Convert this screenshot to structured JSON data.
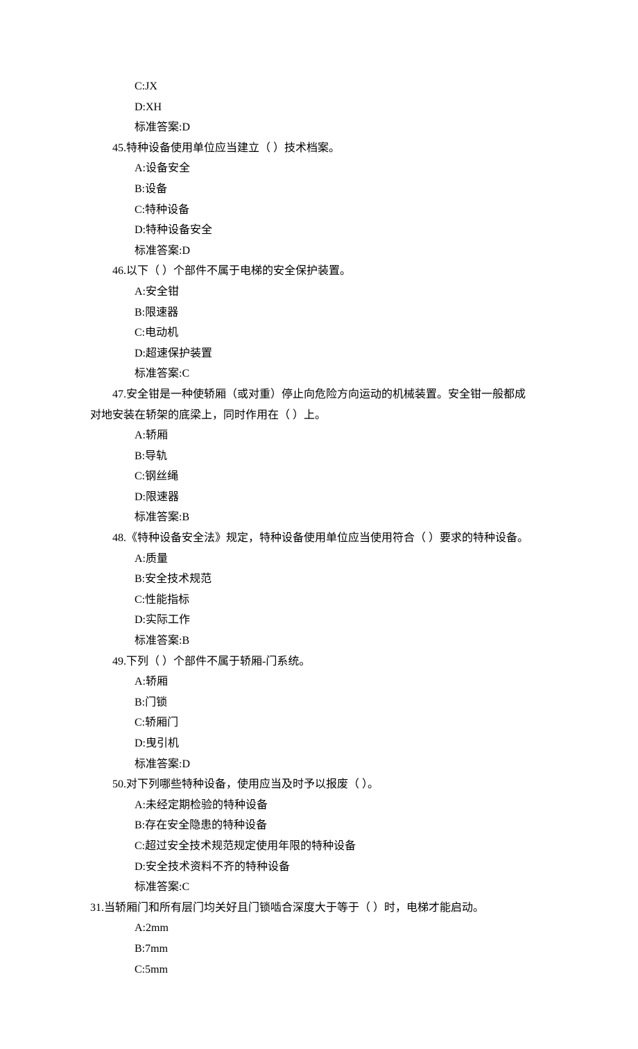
{
  "leading": {
    "cText": "C:JX",
    "dText": "D:XH",
    "answer": "标准答案:D"
  },
  "questions": [
    {
      "num": "45",
      "stem": "特种设备使用单位应当建立（  ）技术档案。",
      "opts": [
        "A:设备安全",
        "B:设备",
        "C:特种设备",
        "D:特种设备安全"
      ],
      "answer": "标准答案:D"
    },
    {
      "num": "46",
      "stem": "以下（  ）个部件不属于电梯的安全保护装置。",
      "opts": [
        "A:安全钳",
        "B:限速器",
        "C:电动机",
        "D:超速保护装置"
      ],
      "answer": "标准答案:C"
    },
    {
      "num": "47",
      "stem_line1": "47.安全钳是一种使轿厢（或对重）停止向危险方向运动的机械装置。安全钳一般都成",
      "stem_line2": "对地安装在轿架的底梁上，同时作用在（  ）上。",
      "opts": [
        "A:轿厢",
        "B:导轨",
        "C:钢丝绳",
        "D:限速器"
      ],
      "answer": "标准答案:B"
    },
    {
      "num": "48",
      "stem": "《特种设备安全法》规定，特种设备使用单位应当使用符合（  ）要求的特种设备。",
      "opts": [
        "A:质量",
        "B:安全技术规范",
        "C:性能指标",
        "D:实际工作"
      ],
      "answer": "标准答案:B"
    },
    {
      "num": "49",
      "stem": "下列（  ）个部件不属于轿厢-门系统。",
      "opts": [
        "A:轿厢",
        "B:门锁",
        "C:轿厢门",
        "D:曳引机"
      ],
      "answer": "标准答案:D"
    },
    {
      "num": "50",
      "stem": "对下列哪些特种设备，使用应当及时予以报废（  ）。",
      "opts": [
        "A:未经定期检验的特种设备",
        "B:存在安全隐患的特种设备",
        "C:超过安全技术规范规定使用年限的特种设备",
        "D:安全技术资料不齐的特种设备"
      ],
      "answer": "标准答案:C"
    }
  ],
  "q31": {
    "stem": "31.当轿厢门和所有层门均关好且门锁啮合深度大于等于（  ）时，电梯才能启动。",
    "opts": [
      "A:2mm",
      "B:7mm",
      "C:5mm"
    ]
  }
}
